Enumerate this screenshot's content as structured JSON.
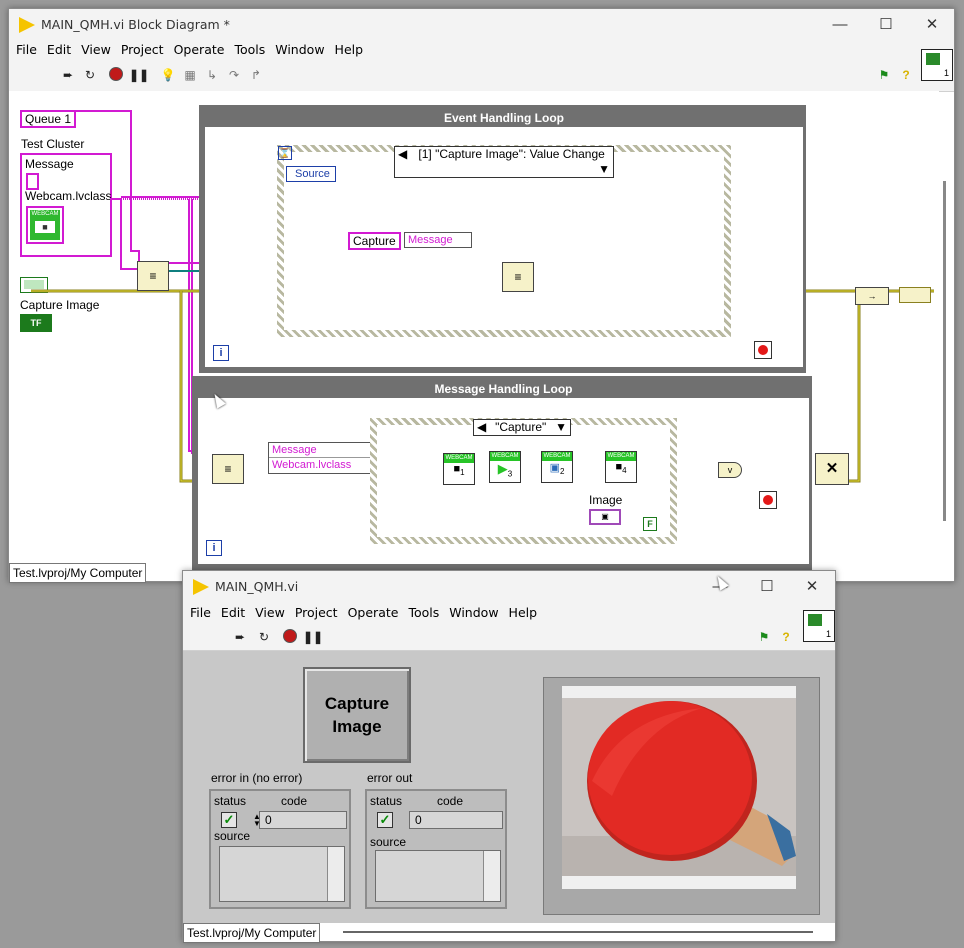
{
  "block_diagram_window": {
    "title": "MAIN_QMH.vi Block Diagram *",
    "menu": [
      "File",
      "Edit",
      "View",
      "Project",
      "Operate",
      "Tools",
      "Window",
      "Help"
    ],
    "status": "Test.lvproj/My Computer",
    "controls": {
      "queue": "Queue 1",
      "test_cluster_label": "Test Cluster",
      "message_label": "Message",
      "webcam_class_label": "Webcam.lvclass",
      "capture_image_label": "Capture Image",
      "capture_constant": "Capture",
      "message_unbundle": "Message",
      "source": "Source",
      "bool_const": "TF",
      "false_const": "F",
      "image_label": "Image"
    },
    "event_loop": {
      "title": "Event Handling Loop",
      "case": "[1] \"Capture Image\": Value Change",
      "iteration": "i"
    },
    "message_loop": {
      "title": "Message Handling Loop",
      "case": "\"Capture\"",
      "iteration": "i",
      "unbundle_fields": [
        "Message",
        "Webcam.lvclass"
      ],
      "webcam_steps": [
        "1",
        "3",
        "2",
        "4"
      ]
    },
    "webcam_text": "WEBCAM"
  },
  "front_panel_window": {
    "title": "MAIN_QMH.vi",
    "menu": [
      "File",
      "Edit",
      "View",
      "Project",
      "Operate",
      "Tools",
      "Window",
      "Help"
    ],
    "status": "Test.lvproj/My Computer",
    "capture_button": "Capture Image",
    "error_in": {
      "title": "error in (no error)",
      "status_label": "status",
      "code_label": "code",
      "code_value": "0",
      "source_label": "source"
    },
    "error_out": {
      "title": "error out",
      "status_label": "status",
      "code_label": "code",
      "code_value": "0",
      "source_label": "source"
    }
  },
  "colors": {
    "class_wire": "#d21ad2",
    "error_wire": "#d4c600",
    "queue_wire": "#0f7f7f",
    "loop_border": "#707070"
  }
}
